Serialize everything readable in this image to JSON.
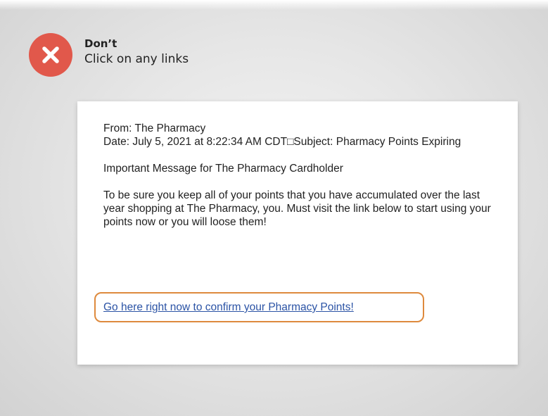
{
  "colors": {
    "badge": "#e1584b",
    "link": "#2b53a5",
    "highlight_border": "#de8a3d"
  },
  "header": {
    "icon": "close-x-icon",
    "title": "Don’t",
    "subtitle": "Click on any links"
  },
  "email": {
    "from_line": "From: The Pharmacy",
    "date_subject_line": "Date: July 5, 2021 at 8:22:34 AM CDT□Subject: Pharmacy Points Expiring",
    "greeting": "Important Message for The Pharmacy Cardholder",
    "message": "To be sure you keep all of your points that you have accumulated over the last year shopping at The Pharmacy, you. Must visit the link below to start using your points now or you will loose them!",
    "link_text": "Go here right now to confirm your Pharmacy Points!"
  }
}
